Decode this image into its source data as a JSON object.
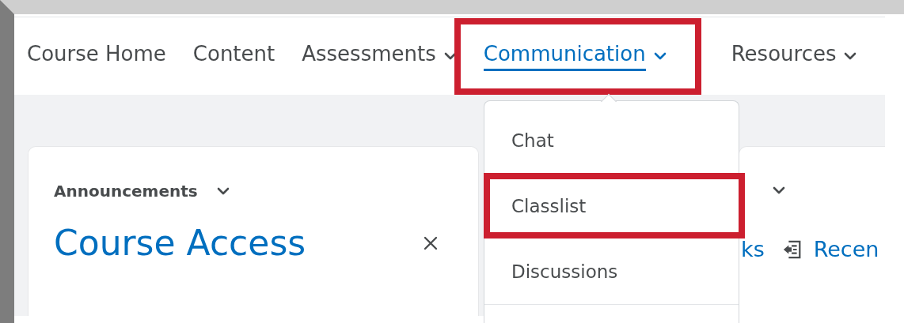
{
  "nav": {
    "items": [
      {
        "label": "Course Home",
        "dropdown": false,
        "selected": false,
        "highlighted": false
      },
      {
        "label": "Content",
        "dropdown": false,
        "selected": false,
        "highlighted": false
      },
      {
        "label": "Assessments",
        "dropdown": true,
        "selected": false,
        "highlighted": false
      },
      {
        "label": "Communication",
        "dropdown": true,
        "selected": true,
        "highlighted": true
      },
      {
        "label": "Resources",
        "dropdown": true,
        "selected": false,
        "highlighted": false
      }
    ]
  },
  "menu": {
    "items": [
      {
        "label": "Chat",
        "highlighted": false
      },
      {
        "label": "Classlist",
        "highlighted": true
      },
      {
        "label": "Discussions",
        "highlighted": false
      }
    ]
  },
  "announcements": {
    "heading": "Announcements",
    "title": "Course Access"
  },
  "right_widget": {
    "links": [
      "ks",
      "Recen"
    ]
  }
}
